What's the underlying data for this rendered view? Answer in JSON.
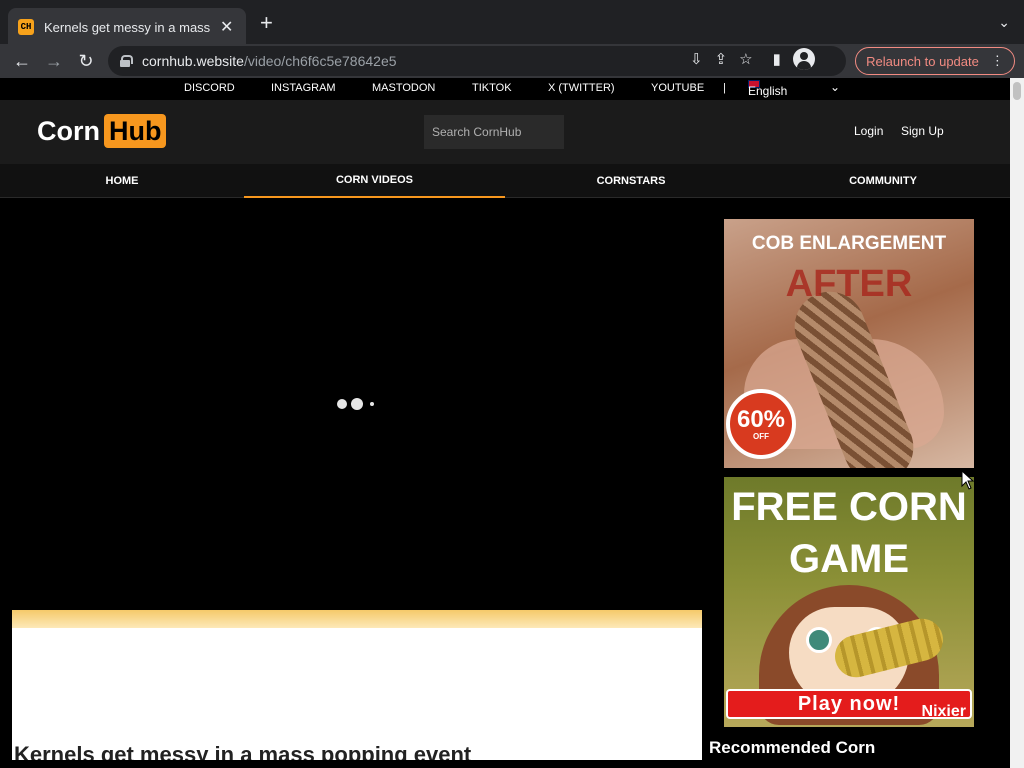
{
  "browser": {
    "tab_title": "Kernels get messy in a mass popping event",
    "favicon_text": "CH",
    "url_host": "cornhub.website",
    "url_path": "/video/ch6f6c5e78642e5",
    "relaunch_label": "Relaunch to update"
  },
  "social_links": [
    {
      "label": "DISCORD"
    },
    {
      "label": "INSTAGRAM"
    },
    {
      "label": "MASTODON"
    },
    {
      "label": "TIKTOK"
    },
    {
      "label": "X (TWITTER)"
    },
    {
      "label": "YOUTUBE"
    }
  ],
  "separator": "|",
  "language": "English",
  "header": {
    "logo_part1": "Corn",
    "logo_part2": "Hub",
    "search_placeholder": "Search CornHub",
    "login": "Login",
    "signup": "Sign Up"
  },
  "nav": [
    {
      "label": "HOME",
      "active": false
    },
    {
      "label": "CORN VIDEOS",
      "active": true
    },
    {
      "label": "CORNSTARS",
      "active": false
    },
    {
      "label": "COMMUNITY",
      "active": false
    }
  ],
  "video": {
    "title": "Kernels get messy in a mass popping event"
  },
  "ads": {
    "ad1_title": "COB ENLARGEMENT",
    "ad1_after": "AFTER",
    "ad1_badge_value": "60%",
    "ad1_badge_text": "OFF",
    "ad2_title": "FREE CORN GAME",
    "ad2_cta": "Play now!",
    "ad2_brand": "Nixier"
  },
  "sidebar": {
    "recommended_heading": "Recommended Corn"
  },
  "colors": {
    "accent": "#f7971e",
    "relaunch": "#f28b82"
  }
}
